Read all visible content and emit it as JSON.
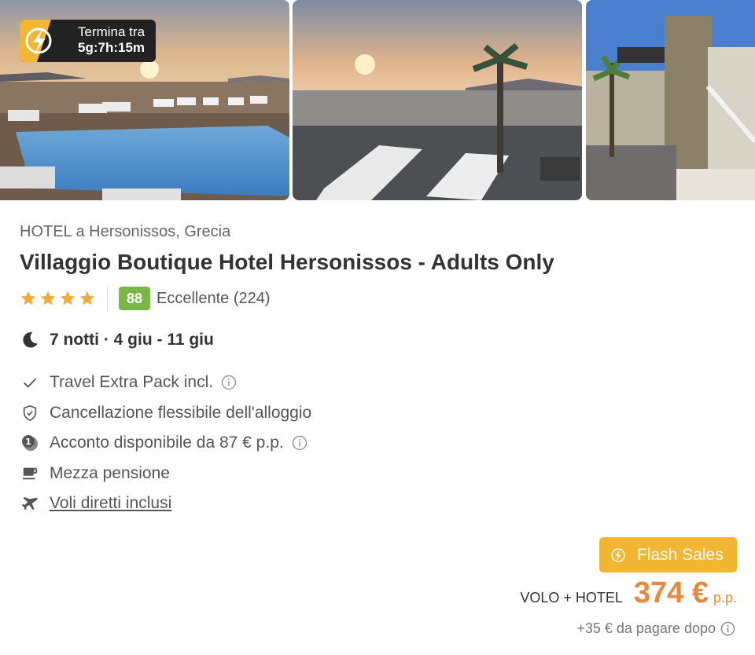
{
  "gallery": {
    "timer": {
      "label": "Termina tra",
      "value": "5g:7h:15m"
    }
  },
  "hotel": {
    "meta": "HOTEL a Hersonissos, Grecia",
    "name": "Villaggio Boutique Hotel Hersonissos - Adults Only",
    "stars": 4,
    "score": "88",
    "review": "Eccellente (224)"
  },
  "stay": {
    "dates": "7 notti · 4 giu - 11 giu"
  },
  "features": [
    {
      "icon": "check-icon",
      "text": "Travel Extra Pack incl."
    },
    {
      "icon": "shield-check-icon",
      "text": "Cancellazione flessibile dell'alloggio"
    },
    {
      "icon": "deposit-icon",
      "text": "Acconto disponibile da 87 € p.p."
    },
    {
      "icon": "coffee-cup-icon",
      "text": "Mezza pensione"
    },
    {
      "icon": "airplane-icon",
      "text": "Voli diretti inclusi"
    }
  ],
  "badge": {
    "label": "Flash Sales"
  },
  "price": {
    "label": "VOLO + HOTEL",
    "value": "374 €",
    "unit": "p.p.",
    "extra": "+35 € da pagare dopo"
  },
  "colors": {
    "accent": "#f2b632",
    "price": "#e8893c",
    "score": "#7ab648"
  }
}
